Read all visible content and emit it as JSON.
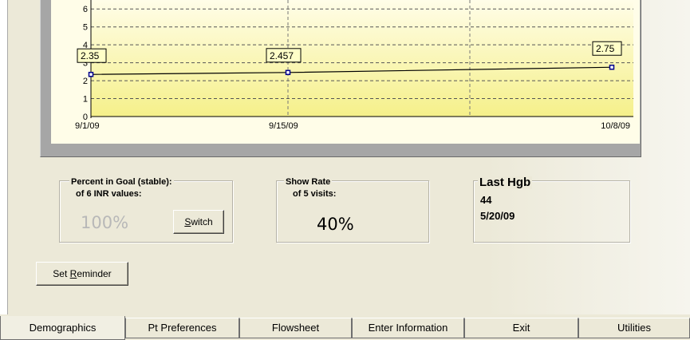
{
  "chart_data": {
    "type": "line",
    "x": [
      "9/1/09",
      "9/15/09",
      "10/8/09"
    ],
    "y": [
      2.35,
      2.457,
      2.75
    ],
    "data_labels": [
      "2.35",
      "2.457",
      "2.75"
    ],
    "x_tick_labels": [
      "9/1/09",
      "9/15/09",
      "10/8/09"
    ],
    "y_ticks": [
      "0",
      "1",
      "2",
      "3",
      "4",
      "5",
      "6"
    ],
    "ylim": [
      0,
      6.5
    ],
    "grid": true,
    "colors": {
      "background_top": "#fffde8",
      "background_bottom": "#f5f08a",
      "line": "#000000",
      "marker": "#00008b",
      "label_box": "#ffffc8"
    }
  },
  "goal": {
    "title": "Percent in Goal (stable):",
    "subtitle": "of 6 INR values:",
    "value": "100%",
    "switch_prefix": "",
    "switch_mnemonic": "S",
    "switch_rest": "witch"
  },
  "show_rate": {
    "title": "Show Rate",
    "subtitle": "of 5 visits:",
    "value": "40%"
  },
  "last_hgb": {
    "title": "Last Hgb",
    "value": "44",
    "date": "5/20/09"
  },
  "reminder": {
    "prefix": "Set ",
    "mnemonic": "R",
    "rest": "eminder"
  },
  "tabs": [
    {
      "label": "Demographics",
      "active": true
    },
    {
      "label": "Pt Preferences",
      "active": false
    },
    {
      "label": "Flowsheet",
      "active": false
    },
    {
      "label": "Enter Information",
      "active": false
    },
    {
      "label": "Exit",
      "active": false
    },
    {
      "label": "Utilities",
      "active": false
    }
  ]
}
